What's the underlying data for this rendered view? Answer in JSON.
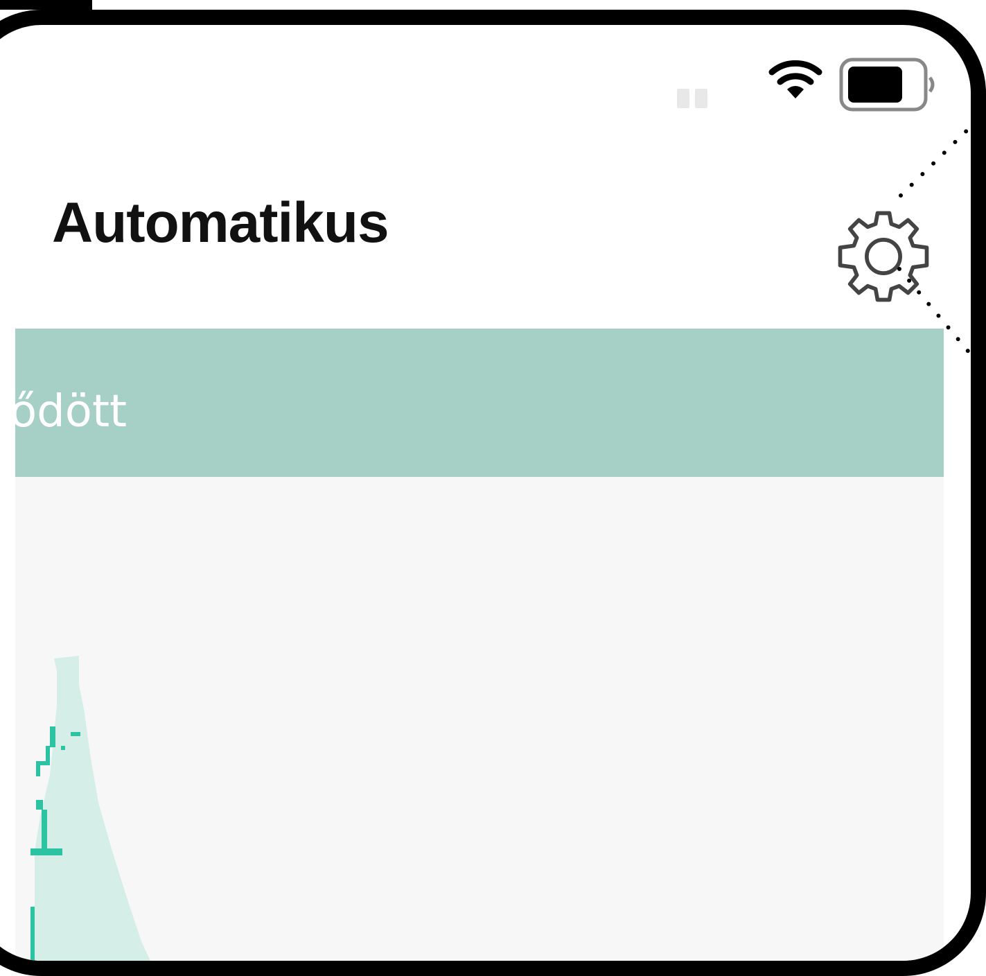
{
  "app": {
    "title": "Automatikus"
  },
  "status_banner": {
    "text": "ődött"
  },
  "header": {
    "settings_icon": "gear-icon"
  },
  "status_bar": {
    "wifi_icon": "wifi-icon",
    "battery_icon": "battery-icon",
    "signal_icon": "signal-icon"
  },
  "colors": {
    "banner": "#a6cfc5",
    "chart_background": "#f7f7f7",
    "sensor_line": "#2cc3a2",
    "area_fill": "#d5eee7",
    "orange_band": "#f5a623"
  }
}
